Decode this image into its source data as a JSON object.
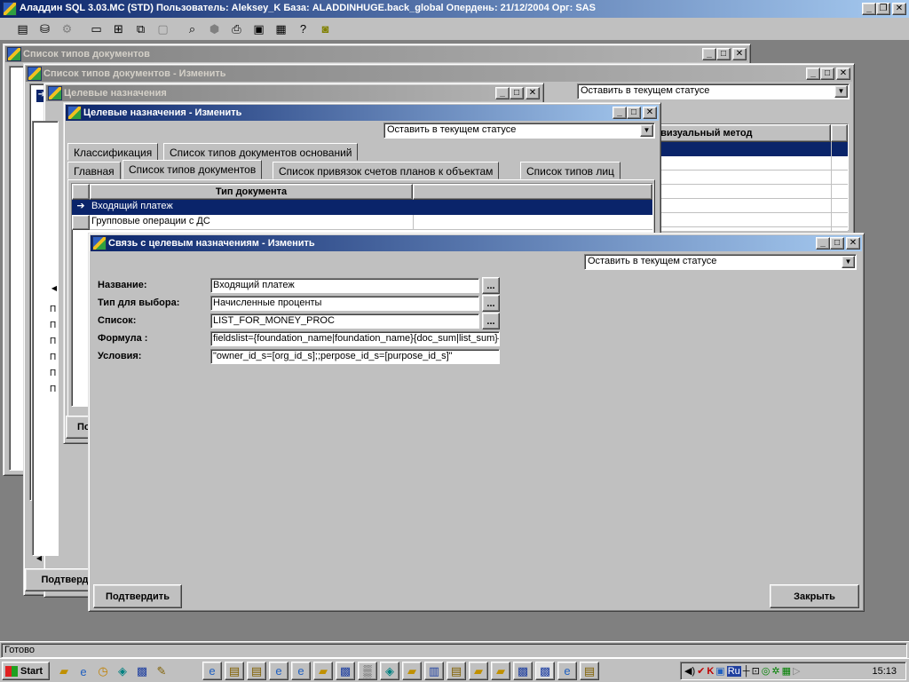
{
  "app": {
    "title": "Аладдин SQL 3.03.МС (STD)  Пользователь: Aleksey_K База: ALADDINHUGE.back_global Опердень: 21/12/2004 Орг: SAS",
    "status": "Готово"
  },
  "windows": {
    "w1": {
      "title": "Список типов документов"
    },
    "w2": {
      "title": "Список типов документов - Изменить",
      "status_combo": "Оставить в текущем статусе",
      "col_header": "евизуальный метод"
    },
    "w3": {
      "title": "Целевые назначения",
      "confirm_label": "Подтверд"
    },
    "w4": {
      "title": "Целевые назначения - Изменить",
      "status_combo": "Оставить в текущем статусе",
      "tabs_row1": [
        "Классификация",
        "Список типов документов оснований"
      ],
      "tabs_row2": [
        "Главная",
        "Список типов документов",
        "Список привязок счетов планов к объектам",
        "Список типов лиц"
      ],
      "grid_header": "Тип документа",
      "rows": [
        "Входящий платеж",
        "Групповые операции с ДС"
      ],
      "left_rows": [
        "П",
        "П",
        "П",
        "П",
        "П",
        "П"
      ],
      "confirm_label": "По"
    },
    "w5": {
      "title": "Связь с целевым назначениям - Изменить",
      "status_combo": "Оставить в текущем статусе",
      "fields": {
        "name_label": "Название:",
        "name_value": "Входящий платеж",
        "type_label": "Тип для выбора:",
        "type_value": "Начисленные проценты",
        "list_label": "Список:",
        "list_value": "LIST_FOR_MONEY_PROC",
        "formula_label": "Формула :",
        "formula_value": "fieldslist={foundation_name|foundation_name}{doc_sum|list_sum}{to_",
        "cond_label": "Условия:",
        "cond_value": "\"owner_id_s=[org_id_s];;perpose_id_s=[purpose_id_s]\""
      },
      "ellipsis": "...",
      "confirm_label": "Подтвердить",
      "close_label": "Закрыть"
    }
  },
  "taskbar": {
    "start_label": "Start",
    "clock": "15:13",
    "lang": "Ru"
  }
}
